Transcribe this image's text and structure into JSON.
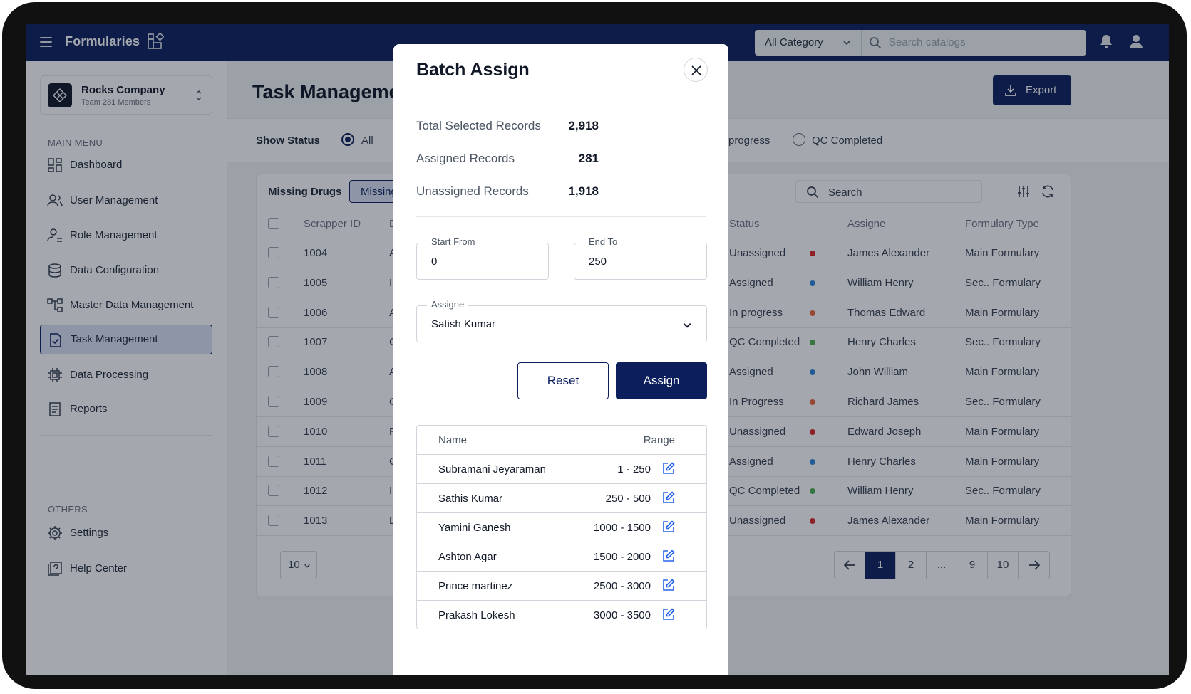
{
  "app": {
    "title": "Formularies"
  },
  "topbar": {
    "category": "All Category",
    "search_placeholder": "Search catalogs"
  },
  "company": {
    "name": "Rocks Company",
    "sub": "Team 281 Members"
  },
  "sidebar": {
    "main_label": "MAIN MENU",
    "items": [
      {
        "label": "Dashboard",
        "icon": "grid-icon"
      },
      {
        "label": "User Management",
        "icon": "users-icon"
      },
      {
        "label": "Role Management",
        "icon": "role-icon"
      },
      {
        "label": "Data Configuration",
        "icon": "database-icon"
      },
      {
        "label": "Master Data Management",
        "icon": "hierarchy-icon"
      },
      {
        "label": "Task Management",
        "icon": "file-check-icon",
        "active": true
      },
      {
        "label": "Data Processing",
        "icon": "chip-icon"
      },
      {
        "label": "Reports",
        "icon": "report-icon"
      }
    ],
    "others_label": "OTHERS",
    "others": [
      {
        "label": "Settings",
        "icon": "gear-icon"
      },
      {
        "label": "Help Center",
        "icon": "help-icon"
      }
    ]
  },
  "main": {
    "title": "Task Manageme",
    "export_label": "Export",
    "status_label": "Show Status",
    "status_options": [
      "All",
      "progress",
      "QC Completed"
    ],
    "card_title": "Missing Drugs",
    "chip_label": "Missing",
    "search_label": "Search",
    "columns": [
      "Scrapper ID",
      "D",
      "Status",
      "Assigne",
      "Formulary Type"
    ],
    "rows": [
      {
        "id": "1004",
        "d": "A",
        "status": "Unassigned",
        "color": "#dc2626",
        "assignee": "James Alexander",
        "type": "Main Formulary"
      },
      {
        "id": "1005",
        "d": "I",
        "status": "Assigned",
        "color": "#2e86de",
        "assignee": "William Henry",
        "type": "Sec.. Formulary"
      },
      {
        "id": "1006",
        "d": "A",
        "status": "In progress",
        "color": "#e8663b",
        "assignee": "Thomas Edward",
        "type": "Main Formulary"
      },
      {
        "id": "1007",
        "d": "C",
        "status": "QC Completed",
        "color": "#4caf50",
        "assignee": "Henry Charles",
        "type": "Sec.. Formulary"
      },
      {
        "id": "1008",
        "d": "A",
        "status": "Assigned",
        "color": "#2e86de",
        "assignee": "John William",
        "type": "Main Formulary"
      },
      {
        "id": "1009",
        "d": "C",
        "status": "In Progress",
        "color": "#e8663b",
        "assignee": "Richard James",
        "type": "Sec.. Formulary"
      },
      {
        "id": "1010",
        "d": "R",
        "status": "Unassigned",
        "color": "#dc2626",
        "assignee": "Edward Joseph",
        "type": "Main Formulary"
      },
      {
        "id": "1011",
        "d": "C",
        "status": "Assigned",
        "color": "#2e86de",
        "assignee": "Henry Charles",
        "type": "Main Formulary"
      },
      {
        "id": "1012",
        "d": "I",
        "status": "QC Completed",
        "color": "#4caf50",
        "assignee": "William Henry",
        "type": "Sec.. Formulary"
      },
      {
        "id": "1013",
        "d": "D",
        "status": "Unassigned",
        "color": "#dc2626",
        "assignee": "James Alexander",
        "type": "Main Formulary"
      }
    ],
    "per_page": "10",
    "pages": [
      "1",
      "2",
      "...",
      "9",
      "10"
    ]
  },
  "modal": {
    "title": "Batch Assign",
    "stats": [
      {
        "label": "Total Selected Records",
        "value": "2,918"
      },
      {
        "label": "Assigned Records",
        "value": "281"
      },
      {
        "label": "Unassigned Records",
        "value": "1,918"
      }
    ],
    "start_label": "Start From",
    "start_value": "0",
    "end_label": "End To",
    "end_value": "250",
    "assignee_label": "Assigne",
    "assignee_value": "Satish Kumar",
    "reset_label": "Reset",
    "assign_label": "Assign",
    "table_headers": {
      "name": "Name",
      "range": "Range"
    },
    "assignments": [
      {
        "name": "Subramani Jeyaraman",
        "range": "1 - 250"
      },
      {
        "name": "Sathis Kumar",
        "range": "250 - 500"
      },
      {
        "name": "Yamini Ganesh",
        "range": "1000 - 1500"
      },
      {
        "name": "Ashton Agar",
        "range": "1500 - 2000"
      },
      {
        "name": "Prince martinez",
        "range": "2500 - 3000"
      },
      {
        "name": "Prakash Lokesh",
        "range": "3000 - 3500"
      }
    ]
  },
  "colors": {
    "brand": "#0c1f5c",
    "active_bg": "#dbe3f4"
  }
}
